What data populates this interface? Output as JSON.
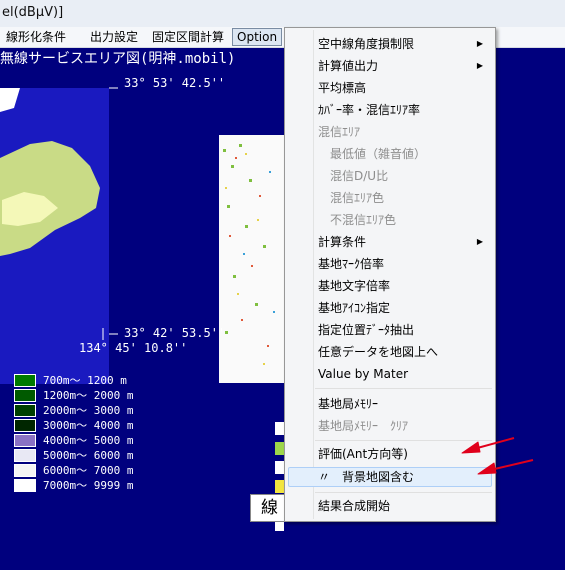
{
  "window": {
    "title": "el(dBμV)]"
  },
  "menubar": {
    "items": [
      "線形化条件",
      "出力設定",
      "固定区間計算",
      "Option"
    ],
    "active": "Option"
  },
  "map": {
    "title": "無線サービスエリア図(明神.mobil)",
    "lat_top": "33°  53'  42.5''",
    "lat_bottom": "33°  42'  53.5''",
    "lon_bottom": "134°  45'  10.8''"
  },
  "legend": [
    {
      "color": "#007a00",
      "label": "700m～ 1200 m"
    },
    {
      "color": "#005a00",
      "label": "1200m～ 2000 m"
    },
    {
      "color": "#004000",
      "label": "2000m～ 3000 m"
    },
    {
      "color": "#002600",
      "label": "3000m～ 4000 m"
    },
    {
      "color": "#8a72c4",
      "label": "4000m～ 5000 m"
    },
    {
      "color": "#e8e8f4",
      "label": "5000m～ 6000 m"
    },
    {
      "color": "#f4f4f4",
      "label": "6000m～ 7000 m"
    },
    {
      "color": "#ffffff",
      "label": "7000m～ 9999 m"
    }
  ],
  "menu": {
    "items": [
      {
        "label": "空中線角度損制限",
        "submenu": true,
        "disabled": false
      },
      {
        "label": "計算値出力",
        "submenu": true,
        "disabled": false
      },
      {
        "label": "平均標高",
        "submenu": false,
        "disabled": false
      },
      {
        "label": "ｶﾊﾞｰ率・混信ｴﾘｱ率",
        "submenu": false,
        "disabled": false
      },
      {
        "label": "混信ｴﾘｱ",
        "submenu": false,
        "disabled": true
      },
      {
        "label": "最低値（雑音値）",
        "submenu": false,
        "disabled": true,
        "indent": true
      },
      {
        "label": "混信D/U比",
        "submenu": false,
        "disabled": true,
        "indent": true
      },
      {
        "label": "混信ｴﾘｱ色",
        "submenu": false,
        "disabled": true,
        "indent": true
      },
      {
        "label": "不混信ｴﾘｱ色",
        "submenu": false,
        "disabled": true,
        "indent": true
      },
      {
        "label": "計算条件",
        "submenu": true,
        "disabled": false
      },
      {
        "label": "基地ﾏｰｸ倍率",
        "submenu": false,
        "disabled": false
      },
      {
        "label": "基地文字倍率",
        "submenu": false,
        "disabled": false
      },
      {
        "label": "基地ｱｲｺﾝ指定",
        "submenu": false,
        "disabled": false
      },
      {
        "label": "指定位置ﾃﾞｰﾀ抽出",
        "submenu": false,
        "disabled": false
      },
      {
        "label": "任意データを地図上へ",
        "submenu": false,
        "disabled": false
      },
      {
        "label": "Value by Mater",
        "submenu": false,
        "disabled": false
      },
      {
        "label": "基地局ﾒﾓﾘｰ",
        "submenu": false,
        "disabled": false
      },
      {
        "label": "基地局ﾒﾓﾘｰ　ｸﾘｱ",
        "submenu": false,
        "disabled": true
      },
      {
        "label": "評価(Ant方向等)",
        "submenu": false,
        "disabled": false
      },
      {
        "label": "〃　背景地図含む",
        "submenu": false,
        "disabled": false,
        "highlighted": true
      },
      {
        "label": "結果合成開始",
        "submenu": false,
        "disabled": false
      }
    ]
  },
  "bottom_button": {
    "label": "線"
  },
  "colors": {
    "map_bg": "#00007e",
    "arrow": "#e0001b",
    "menu_bg": "#f4f5f7",
    "highlight": "#e3effc"
  }
}
